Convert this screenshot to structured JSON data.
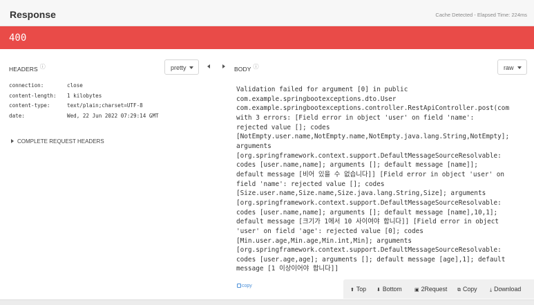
{
  "header": {
    "title": "Response",
    "meta": "Cache Detected - Elapsed Time: 224ms"
  },
  "status": {
    "code": "400",
    "color": "#e94b48"
  },
  "headers_panel": {
    "label": "HEADERS",
    "help_icon": "question-circle-icon",
    "format_dropdown": "pretty",
    "rows": [
      {
        "key": "connection:",
        "value": "close"
      },
      {
        "key": "content-length:",
        "value": "1 kilobytes"
      },
      {
        "key": "content-type:",
        "value": "text/plain;charset=UTF-8"
      },
      {
        "key": "date:",
        "value": "Wed, 22 Jun 2022 07:29:14 GMT"
      }
    ],
    "complete_request_label": "COMPLETE REQUEST HEADERS"
  },
  "body_panel": {
    "label": "BODY",
    "help_icon": "question-circle-icon",
    "format_dropdown": "raw",
    "lines": [
      "Validation failed for argument [0] in public",
      "com.example.springbootexceptions.dto.User",
      "com.example.springbootexceptions.controller.RestApiController.post(com",
      "with 3 errors: [Field error in object 'user' on field 'name':",
      "rejected value []; codes",
      "[NotEmpty.user.name,NotEmpty.name,NotEmpty.java.lang.String,NotEmpty];",
      "arguments",
      "[org.springframework.context.support.DefaultMessageSourceResolvable:",
      "codes [user.name,name]; arguments []; default message [name]];",
      "default message [비어 있을 수 없습니다]] [Field error in object 'user' on",
      "field 'name': rejected value []; codes",
      "[Size.user.name,Size.name,Size.java.lang.String,Size]; arguments",
      "[org.springframework.context.support.DefaultMessageSourceResolvable:",
      "codes [user.name,name]; arguments []; default message [name],10,1];",
      "default message [크기가 1에서 10 사이여야 합니다]] [Field error in object",
      "'user' on field 'age': rejected value [0]; codes",
      "[Min.user.age,Min.age,Min.int,Min]; arguments",
      "[org.springframework.context.support.DefaultMessageSourceResolvable:",
      "codes [user.age,age]; arguments []; default message [age],1]; default",
      "message [1 이상이어야 합니다]]"
    ],
    "copy_label": "copy",
    "actions": {
      "top": "Top",
      "bottom": "Bottom",
      "request": "2Request",
      "copy": "Copy",
      "download": "Download"
    }
  }
}
